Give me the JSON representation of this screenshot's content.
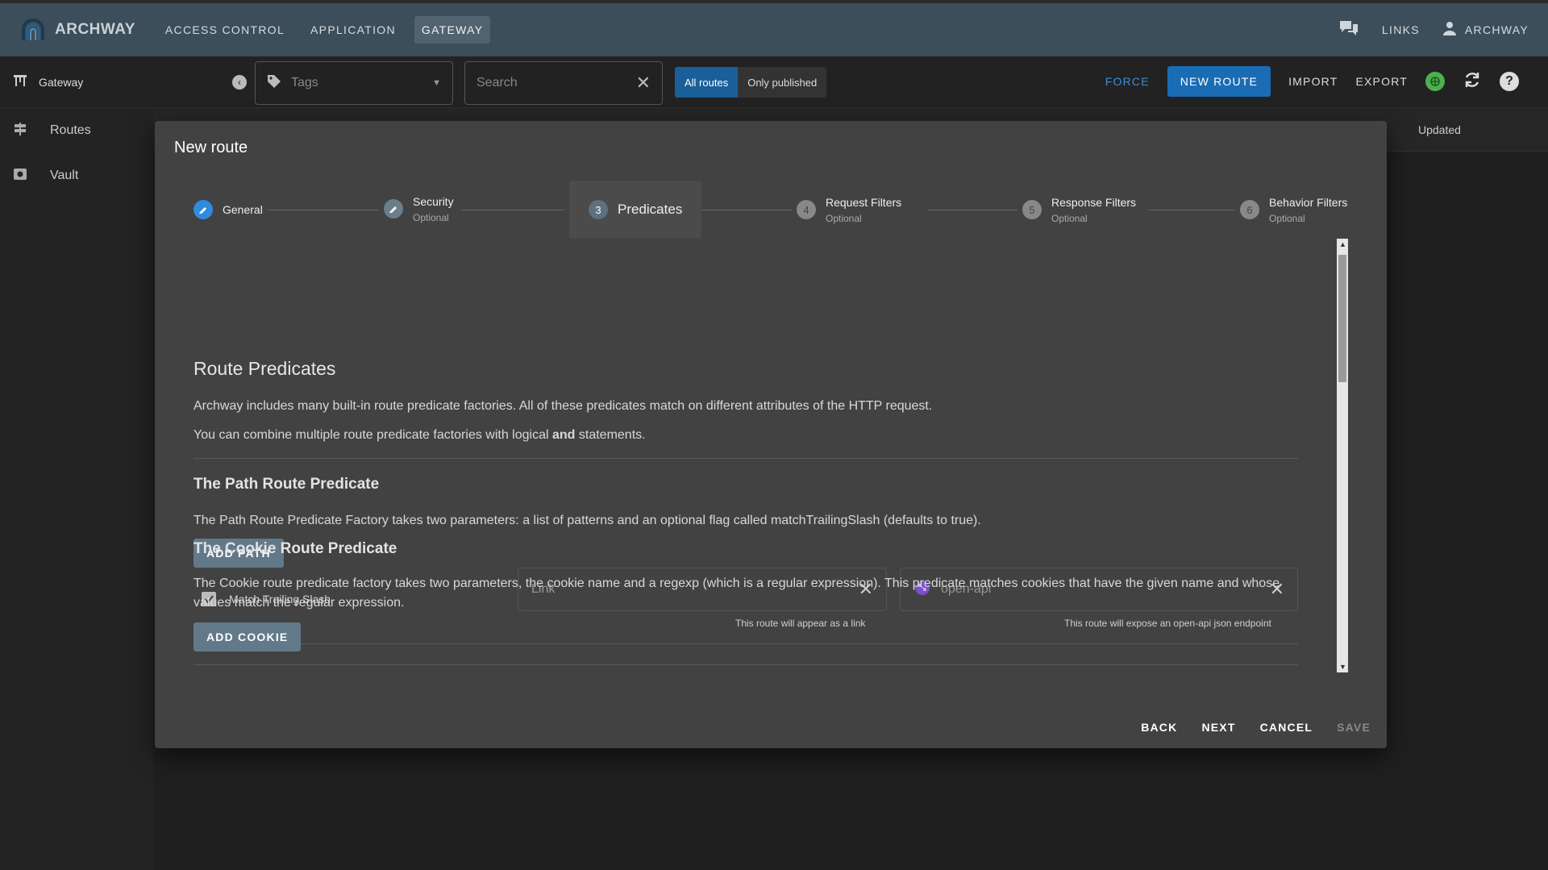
{
  "app": {
    "logo_text": "ARCHWAY",
    "nav": [
      "ACCESS CONTROL",
      "APPLICATION",
      "GATEWAY"
    ],
    "links_label": "LINKS",
    "user_label": "ARCHWAY"
  },
  "toolbar": {
    "title": "Gateway",
    "tags_placeholder": "Tags",
    "search_placeholder": "Search",
    "all_routes": "All routes",
    "only_published": "Only published",
    "force": "FORCE",
    "new_route": "NEW ROUTE",
    "import": "IMPORT",
    "export": "EXPORT"
  },
  "sidebar": {
    "items": [
      {
        "label": "Routes",
        "icon": "signpost-icon"
      },
      {
        "label": "Vault",
        "icon": "vault-icon"
      }
    ]
  },
  "table": {
    "updated_header": "Updated"
  },
  "dialog": {
    "title": "New route",
    "steps": [
      {
        "number": "",
        "label": "General",
        "sub": "",
        "state": "done"
      },
      {
        "number": "",
        "label": "Security",
        "sub": "Optional",
        "state": "edit"
      },
      {
        "number": "3",
        "label": "Predicates",
        "sub": "",
        "state": "active"
      },
      {
        "number": "4",
        "label": "Request Filters",
        "sub": "Optional",
        "state": "todo"
      },
      {
        "number": "5",
        "label": "Response Filters",
        "sub": "Optional",
        "state": "todo"
      },
      {
        "number": "6",
        "label": "Behavior Filters",
        "sub": "Optional",
        "state": "todo"
      }
    ],
    "heading": "Route Predicates",
    "intro_1": "Archway includes many built-in route predicate factories. All of these predicates match on different attributes of the HTTP request.",
    "intro_2_pre": "You can combine multiple route predicate factories with logical ",
    "intro_2_bold": "and",
    "intro_2_post": " statements.",
    "path_section": {
      "title": "The Path Route Predicate",
      "desc": "The Path Route Predicate Factory takes two parameters: a list of patterns and an optional flag called matchTrailingSlash (defaults to true).",
      "add_button": "ADD PATH",
      "checkbox_label": "Match Trailing Slash",
      "checkbox_checked": true,
      "link_placeholder": "Link",
      "link_helper": "This route will appear as a link",
      "openapi_placeholder": "open-api",
      "openapi_helper": "This route will expose an open-api json endpoint"
    },
    "cookie_section": {
      "title": "The Cookie Route Predicate",
      "desc": "The Cookie route predicate factory takes two parameters, the cookie name and a regexp (which is a regular expression). This predicate matches cookies that have the given name and whose values match the regular expression.",
      "add_button": "ADD COOKIE"
    },
    "actions": {
      "back": "BACK",
      "next": "NEXT",
      "cancel": "CANCEL",
      "save": "SAVE"
    }
  }
}
